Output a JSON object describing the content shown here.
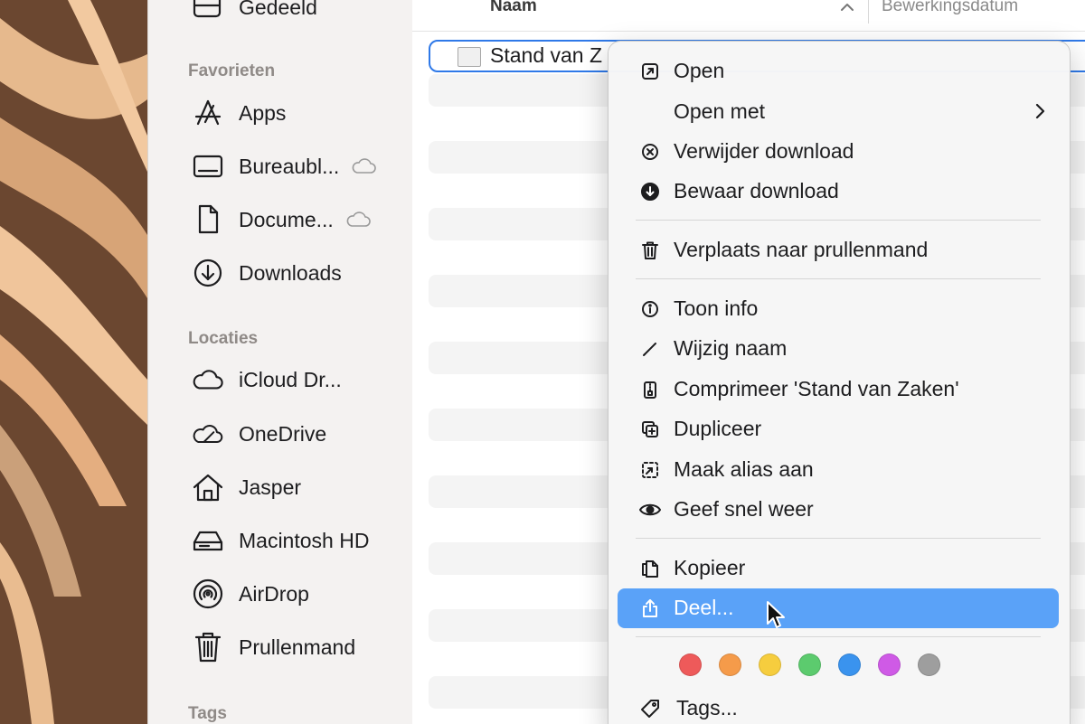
{
  "sidebar": {
    "top_item": "Gedeeld",
    "sections": {
      "favorites": "Favorieten",
      "locations": "Locaties",
      "tags": "Tags"
    },
    "favorites": [
      {
        "label": "Apps",
        "icon": "apps-icon"
      },
      {
        "label": "Bureaubl...",
        "icon": "desktop-icon",
        "cloud": true
      },
      {
        "label": "Docume...",
        "icon": "document-icon",
        "cloud": true
      },
      {
        "label": "Downloads",
        "icon": "download-icon"
      }
    ],
    "locations": [
      {
        "label": "iCloud Dr...",
        "icon": "icloud-icon"
      },
      {
        "label": "OneDrive",
        "icon": "onedrive-icon"
      },
      {
        "label": "Jasper",
        "icon": "home-icon"
      },
      {
        "label": "Macintosh HD",
        "icon": "disk-icon"
      },
      {
        "label": "AirDrop",
        "icon": "airdrop-icon"
      },
      {
        "label": "Prullenmand",
        "icon": "trash-icon"
      }
    ]
  },
  "file_list": {
    "columns": {
      "name": "Naam",
      "date": "Bewerkingsdatum"
    },
    "selected_file": "Stand van Z"
  },
  "context_menu": {
    "items": {
      "open": "Open",
      "open_with": "Open met",
      "remove_download": "Verwijder download",
      "keep_download": "Bewaar download",
      "move_to_trash": "Verplaats naar prullenmand",
      "get_info": "Toon info",
      "rename": "Wijzig naam",
      "compress": "Comprimeer 'Stand van Zaken'",
      "duplicate": "Dupliceer",
      "make_alias": "Maak alias aan",
      "quick_look": "Geef snel weer",
      "copy": "Kopieer",
      "share": "Deel...",
      "tags": "Tags..."
    },
    "highlighted_item": "share",
    "tag_colors": [
      "#ee5a5a",
      "#f59b4a",
      "#f6cd3e",
      "#5ccb6e",
      "#3a93ee",
      "#cf5ae6",
      "#9e9e9e"
    ]
  },
  "colors": {
    "highlight": "#5aa2f8",
    "selection_border": "#2f79e8",
    "sidebar_bg": "#f4f2f1",
    "menu_bg": "#f6f6f6"
  }
}
